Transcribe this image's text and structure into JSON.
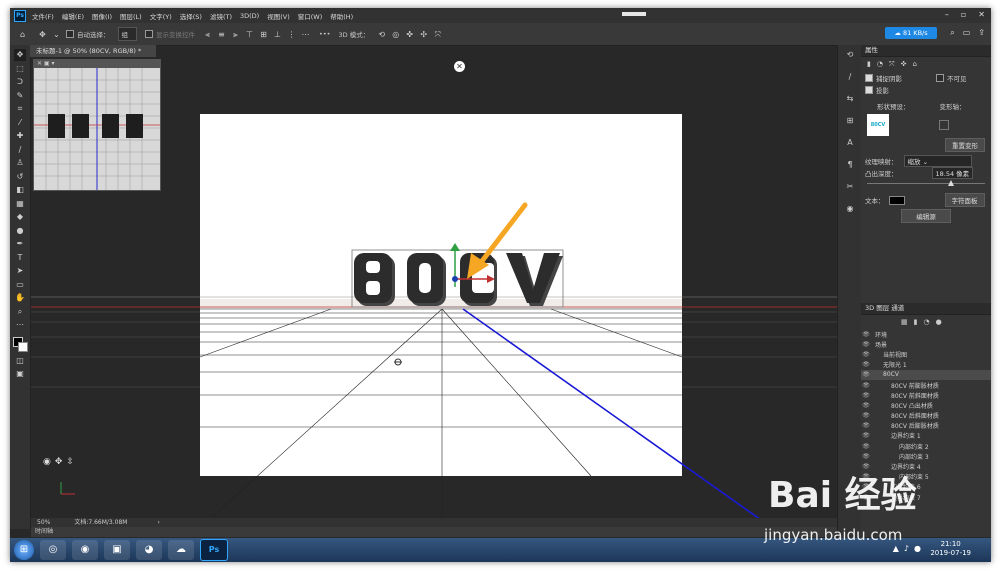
{
  "app": {
    "logo": "Ps"
  },
  "menu": [
    "文件(F)",
    "编辑(E)",
    "图像(I)",
    "图层(L)",
    "文字(Y)",
    "选择(S)",
    "滤镜(T)",
    "3D(D)",
    "视图(V)",
    "窗口(W)",
    "帮助(H)"
  ],
  "window_controls": [
    "–",
    "▫",
    "✕"
  ],
  "options": {
    "auto_select_label": "自动选择：",
    "auto_select_value": "组",
    "show_transform_label": "显示变换控件",
    "more": "•••",
    "mode_label": "3D 模式：",
    "network_speed": "81 KB/s"
  },
  "document": {
    "tab_title": "未标题-1 @ 50% (80CV, RGB/8) *"
  },
  "navigator": {
    "text": "80CV"
  },
  "scene": {
    "text": "80CV"
  },
  "status": {
    "zoom": "50%",
    "doc_info": "文档:7.66M/3.08M"
  },
  "timeline": {
    "label": "时间轴"
  },
  "properties": {
    "title": "属性",
    "catch_shadows": "捕捉阴影",
    "invisible": "不可见",
    "cast_shadows": "投影",
    "shape_preset_label": "形状预设：",
    "deform_axis_label": "变形轴：",
    "thumb_text": "80CV",
    "reset_deform": "重置变形",
    "texture_map_label": "纹理映射：",
    "texture_map_value": "缩放",
    "extrusion_label": "凸出深度：",
    "extrusion_value": "18.54 像素",
    "extrusion_level": 0.72,
    "text_label": "文本：",
    "char_panel": "字符面板",
    "edit_source": "编辑源",
    "text_color": "#000000"
  },
  "layers_panel": {
    "tabs": "3D   图层   通道",
    "rows": [
      {
        "label": "环境",
        "indent": 0,
        "selected": false
      },
      {
        "label": "场景",
        "indent": 0,
        "selected": false
      },
      {
        "label": "当前视图",
        "indent": 1,
        "selected": false
      },
      {
        "label": "无限光 1",
        "indent": 1,
        "selected": false
      },
      {
        "label": "80CV",
        "indent": 1,
        "selected": true
      },
      {
        "label": "80CV 前膨胀材质",
        "indent": 2,
        "selected": false
      },
      {
        "label": "80CV 前斜面材质",
        "indent": 2,
        "selected": false
      },
      {
        "label": "80CV 凸出材质",
        "indent": 2,
        "selected": false
      },
      {
        "label": "80CV 后斜面材质",
        "indent": 2,
        "selected": false
      },
      {
        "label": "80CV 后膨胀材质",
        "indent": 2,
        "selected": false
      },
      {
        "label": "边界约束 1",
        "indent": 2,
        "selected": false
      },
      {
        "label": "内部约束 2",
        "indent": 3,
        "selected": false
      },
      {
        "label": "内部约束 3",
        "indent": 3,
        "selected": false
      },
      {
        "label": "边界约束 4",
        "indent": 2,
        "selected": false
      },
      {
        "label": "内部约束 5",
        "indent": 3,
        "selected": false
      },
      {
        "label": "边界约束 6",
        "indent": 2,
        "selected": false
      },
      {
        "label": "边界约束 7",
        "indent": 2,
        "selected": false
      }
    ]
  },
  "taskbar": {
    "clock_time": "21:10",
    "clock_date": "2019-07-19"
  },
  "watermark": {
    "brand": "Bai  经验",
    "url": "jingyan.baidu.com"
  },
  "colors": {
    "accent": "#1e88e5",
    "arrow": "#f5a623",
    "axis_blue": "#1a1ad6",
    "axis_red": "#d03030"
  }
}
